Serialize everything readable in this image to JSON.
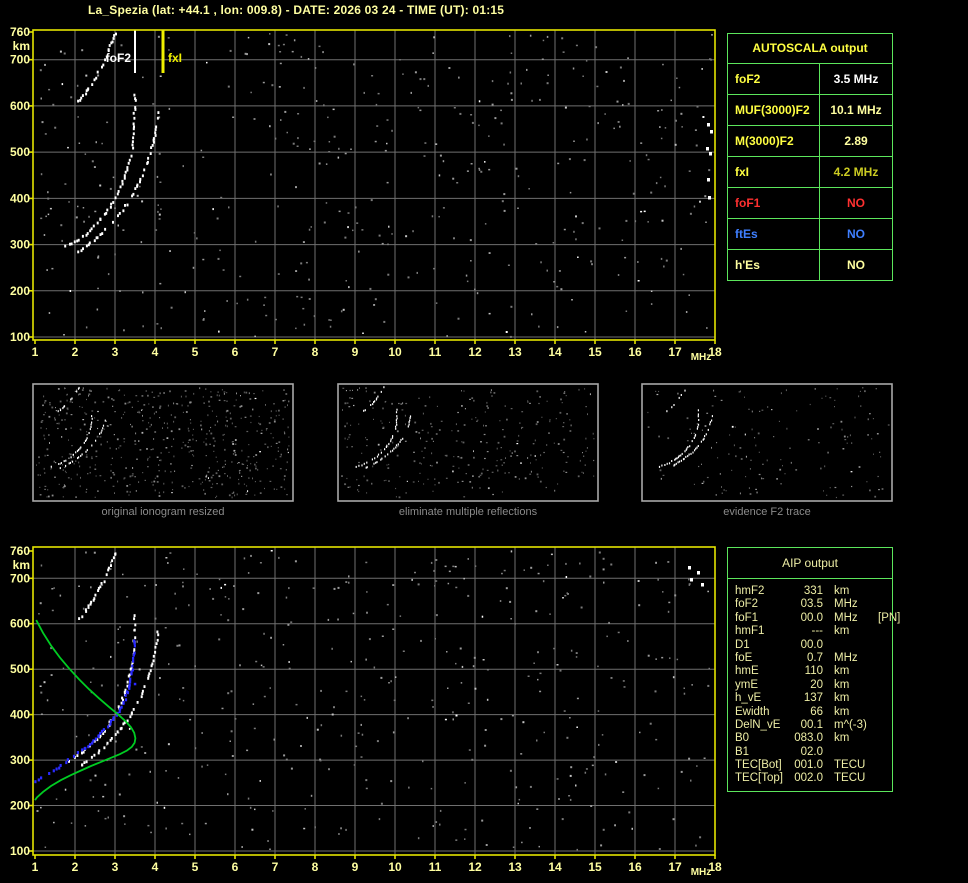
{
  "title": "La_Spezia (lat: +44.1 , lon: 009.8) - DATE: 2026 03 24 - TIME (UT): 01:15",
  "autoscala": {
    "header": "AUTOSCALA output",
    "rows": [
      {
        "label": "foF2",
        "value": "3.5 MHz",
        "label_color": "#ffff42",
        "value_color": "#ffffff"
      },
      {
        "label": "MUF(3000)F2",
        "value": "10.1 MHz",
        "label_color": "#ffff42",
        "value_color": "#ffffa0"
      },
      {
        "label": "M(3000)F2",
        "value": "2.89",
        "label_color": "#ffff42",
        "value_color": "#ffffa0"
      },
      {
        "label": "fxI",
        "value": "4.2 MHz",
        "label_color": "#ffff42",
        "value_color": "#cccc22"
      },
      {
        "label": "foF1",
        "value": "NO",
        "label_color": "#ff3030",
        "value_color": "#ff3030"
      },
      {
        "label": "ftEs",
        "value": "NO",
        "label_color": "#3f7fff",
        "value_color": "#3f7fff"
      },
      {
        "label": "h'Es",
        "value": "NO",
        "label_color": "#ffffa0",
        "value_color": "#ffffa0"
      }
    ]
  },
  "aip": {
    "header": "AIP output",
    "rows": [
      {
        "name": "hmF2",
        "value": "331",
        "unit": "km",
        "note": ""
      },
      {
        "name": "foF2",
        "value": "03.5",
        "unit": "MHz",
        "note": ""
      },
      {
        "name": "foF1",
        "value": "00.0",
        "unit": "MHz",
        "note": "[PN]"
      },
      {
        "name": "hmF1",
        "value": "---",
        "unit": "km",
        "note": ""
      },
      {
        "name": "D1",
        "value": "00.0",
        "unit": "",
        "note": ""
      },
      {
        "name": "foE",
        "value": "0.7",
        "unit": "MHz",
        "note": ""
      },
      {
        "name": "hmE",
        "value": "110",
        "unit": "km",
        "note": ""
      },
      {
        "name": "ymE",
        "value": "20",
        "unit": "km",
        "note": ""
      },
      {
        "name": "h_vE",
        "value": "137",
        "unit": "km",
        "note": ""
      },
      {
        "name": "Ewidth",
        "value": "66",
        "unit": "km",
        "note": ""
      },
      {
        "name": "DelN_vE",
        "value": "00.1",
        "unit": "m^(-3)",
        "note": ""
      },
      {
        "name": "B0",
        "value": "083.0",
        "unit": "km",
        "note": ""
      },
      {
        "name": "B1",
        "value": "02.0",
        "unit": "",
        "note": ""
      },
      {
        "name": "TEC[Bot]",
        "value": "001.0",
        "unit": "TECU",
        "note": ""
      },
      {
        "name": "TEC[Top]",
        "value": "002.0",
        "unit": "TECU",
        "note": ""
      }
    ]
  },
  "thumbnails": [
    {
      "caption": "original ionogram resized"
    },
    {
      "caption": "eliminate multiple reflections"
    },
    {
      "caption": "evidence F2 trace"
    }
  ],
  "colors": {
    "page_background": "#000000",
    "axis_text_yellow": "#ffffa0",
    "plot_border_yellow": "#e3e300",
    "grid_gray": "#6f6f6f",
    "trace_white": "#ffffff",
    "profile_green": "#00cc22",
    "scaled_trace_blue": "#2a2aff",
    "table_border_green": "#5ce65c",
    "marker_fxi_yellow": "#f0f000",
    "thumb_border_gray": "#a8a8a8",
    "caption_gray": "#8a8a8a"
  },
  "chart_data": {
    "type": "scatter",
    "title": "",
    "x_unit": "MHz",
    "y_unit": "km",
    "xlim": [
      1,
      18
    ],
    "ylim": [
      100,
      760
    ],
    "grid": true,
    "x_ticks": [
      1,
      2,
      3,
      4,
      5,
      6,
      7,
      8,
      9,
      10,
      11,
      12,
      13,
      14,
      15,
      16,
      17,
      18
    ],
    "y_ticks": [
      760,
      700,
      600,
      500,
      400,
      300,
      200,
      100
    ],
    "markers": [
      {
        "label": "foF2",
        "freq_mhz": 3.5,
        "color": "#ffffff",
        "side": "left"
      },
      {
        "label": "fxI",
        "freq_mhz": 4.2,
        "color": "#f0f000",
        "side": "right"
      }
    ],
    "ionogram_traces": {
      "f2_second_hop": [
        [
          2.05,
          612
        ],
        [
          2.14,
          620
        ],
        [
          2.23,
          630
        ],
        [
          2.33,
          642
        ],
        [
          2.43,
          655
        ],
        [
          2.53,
          670
        ],
        [
          2.63,
          686
        ],
        [
          2.72,
          703
        ],
        [
          2.81,
          721
        ],
        [
          2.89,
          738
        ],
        [
          2.97,
          754
        ],
        [
          3.03,
          762
        ]
      ],
      "f2_o_mode": [
        [
          1.75,
          298
        ],
        [
          1.86,
          303
        ],
        [
          1.97,
          308
        ],
        [
          2.08,
          314
        ],
        [
          2.19,
          321
        ],
        [
          2.3,
          329
        ],
        [
          2.41,
          338
        ],
        [
          2.52,
          348
        ],
        [
          2.63,
          359
        ],
        [
          2.74,
          371
        ],
        [
          2.85,
          385
        ],
        [
          2.96,
          400
        ],
        [
          3.06,
          416
        ],
        [
          3.15,
          433
        ],
        [
          3.23,
          451
        ],
        [
          3.3,
          470
        ],
        [
          3.36,
          491
        ],
        [
          3.41,
          513
        ],
        [
          3.44,
          536
        ],
        [
          3.46,
          560
        ],
        [
          3.46,
          583
        ],
        [
          3.47,
          607
        ],
        [
          3.47,
          632
        ]
      ],
      "f2_x_mode": [
        [
          2.08,
          289
        ],
        [
          2.22,
          297
        ],
        [
          2.36,
          306
        ],
        [
          2.5,
          316
        ],
        [
          2.64,
          327
        ],
        [
          2.78,
          339
        ],
        [
          2.92,
          352
        ],
        [
          3.06,
          366
        ],
        [
          3.2,
          382
        ],
        [
          3.34,
          399
        ],
        [
          3.47,
          418
        ],
        [
          3.59,
          438
        ],
        [
          3.7,
          459
        ],
        [
          3.8,
          482
        ],
        [
          3.88,
          505
        ],
        [
          3.95,
          528
        ],
        [
          4.0,
          550
        ],
        [
          4.04,
          572
        ],
        [
          4.06,
          592
        ]
      ]
    },
    "profile_green_mhz_km": [
      [
        1.03,
        608
      ],
      [
        1.2,
        580
      ],
      [
        1.4,
        552
      ],
      [
        1.62,
        526
      ],
      [
        1.85,
        502
      ],
      [
        2.1,
        478
      ],
      [
        2.35,
        456
      ],
      [
        2.6,
        436
      ],
      [
        2.85,
        417
      ],
      [
        3.08,
        400
      ],
      [
        3.27,
        385
      ],
      [
        3.4,
        372
      ],
      [
        3.48,
        360
      ],
      [
        3.51,
        348
      ],
      [
        3.49,
        338
      ],
      [
        3.42,
        329
      ],
      [
        3.3,
        321
      ],
      [
        3.12,
        313
      ],
      [
        2.9,
        305
      ],
      [
        2.65,
        296
      ],
      [
        2.4,
        287
      ],
      [
        2.15,
        277
      ],
      [
        1.9,
        267
      ],
      [
        1.65,
        256
      ],
      [
        1.4,
        243
      ],
      [
        1.2,
        230
      ],
      [
        1.05,
        218
      ],
      [
        1.0,
        212
      ]
    ],
    "scaled_trace_blue_mhz_km": [
      [
        1.0,
        257
      ],
      [
        1.12,
        263
      ],
      [
        1.25,
        270
      ],
      [
        1.38,
        277
      ],
      [
        1.5,
        284
      ],
      [
        1.63,
        291
      ],
      [
        1.75,
        298
      ],
      [
        1.88,
        306
      ],
      [
        2.0,
        314
      ],
      [
        2.12,
        322
      ],
      [
        2.25,
        331
      ],
      [
        2.38,
        341
      ],
      [
        2.5,
        351
      ],
      [
        2.62,
        362
      ],
      [
        2.75,
        374
      ],
      [
        2.88,
        387
      ],
      [
        3.0,
        401
      ],
      [
        3.1,
        416
      ],
      [
        3.2,
        432
      ],
      [
        3.28,
        450
      ],
      [
        3.34,
        470
      ],
      [
        3.39,
        492
      ],
      [
        3.43,
        515
      ],
      [
        3.45,
        540
      ],
      [
        3.46,
        565
      ]
    ]
  }
}
